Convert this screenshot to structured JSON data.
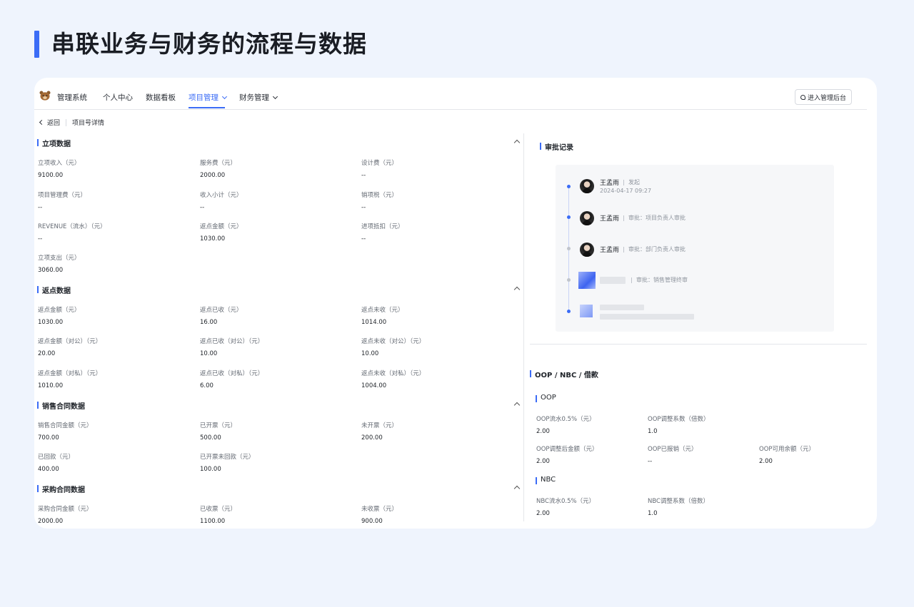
{
  "hero": {
    "title": "串联业务与财务的流程与数据"
  },
  "nav": {
    "brand": "管理系统",
    "items": [
      "个人中心",
      "数据看板",
      "项目管理",
      "财务管理"
    ],
    "admin_button": "进入管理后台"
  },
  "breadcrumb": {
    "back": "返回",
    "current": "项目号详情"
  },
  "sections": {
    "project": {
      "title": "立项数据",
      "fields": [
        {
          "label": "立项收入（元）",
          "value": "9100.00"
        },
        {
          "label": "服务费（元）",
          "value": "2000.00"
        },
        {
          "label": "设计费（元）",
          "value": "--"
        },
        {
          "label": "项目管理费（元）",
          "value": "--"
        },
        {
          "label": "收入小计（元）",
          "value": "--"
        },
        {
          "label": "销项税（元）",
          "value": "--"
        },
        {
          "label": "REVENUE（流水）（元）",
          "value": "--"
        },
        {
          "label": "返点金额（元）",
          "value": "1030.00"
        },
        {
          "label": "进项抵扣（元）",
          "value": "--"
        },
        {
          "label": "立项支出（元）",
          "value": "3060.00"
        }
      ]
    },
    "rebate": {
      "title": "返点数据",
      "fields": [
        {
          "label": "返点金额（元）",
          "value": "1030.00"
        },
        {
          "label": "返点已收（元）",
          "value": "16.00"
        },
        {
          "label": "返点未收（元）",
          "value": "1014.00"
        },
        {
          "label": "返点金额（对公）（元）",
          "value": "20.00"
        },
        {
          "label": "返点已收（对公）（元）",
          "value": "10.00"
        },
        {
          "label": "返点未收（对公）（元）",
          "value": "10.00"
        },
        {
          "label": "返点金额（对私）（元）",
          "value": "1010.00"
        },
        {
          "label": "返点已收（对私）（元）",
          "value": "6.00"
        },
        {
          "label": "返点未收（对私）（元）",
          "value": "1004.00"
        }
      ]
    },
    "sales": {
      "title": "销售合同数据",
      "fields": [
        {
          "label": "销售合同金额（元）",
          "value": "700.00"
        },
        {
          "label": "已开票（元）",
          "value": "500.00"
        },
        {
          "label": "未开票（元）",
          "value": "200.00"
        },
        {
          "label": "已回款（元）",
          "value": "400.00"
        },
        {
          "label": "已开票未回款（元）",
          "value": "100.00"
        }
      ]
    },
    "purchase": {
      "title": "采购合同数据",
      "fields": [
        {
          "label": "采购合同金额（元）",
          "value": "2000.00"
        },
        {
          "label": "已收票（元）",
          "value": "1100.00"
        },
        {
          "label": "未收票（元）",
          "value": "900.00"
        }
      ]
    }
  },
  "approval": {
    "title": "审批记录",
    "records": [
      {
        "name": "王孟雨",
        "action": "发起",
        "time": "2024-04-17 09:27"
      },
      {
        "name": "王孟雨",
        "action": "审批：项目负责人审批"
      },
      {
        "name": "王孟雨",
        "action": "审批：部门负责人审批"
      },
      {
        "name": "",
        "action": "审批：销售管理终审"
      }
    ]
  },
  "oop": {
    "title": "OOP / NBC / 借款",
    "oop_title": "OOP",
    "oop_fields": [
      {
        "label": "OOP流水0.5%（元）",
        "value": "2.00"
      },
      {
        "label": "OOP调整系数（倍数）",
        "value": "1.0"
      },
      {
        "label": "OOP调整后金额（元）",
        "value": "2.00"
      },
      {
        "label": "OOP已报销（元）",
        "value": "--"
      },
      {
        "label": "OOP可用余额（元）",
        "value": "2.00"
      }
    ],
    "nbc_title": "NBC",
    "nbc_fields": [
      {
        "label": "NBC流水0.5%（元）",
        "value": "2.00"
      },
      {
        "label": "NBC调整系数（倍数）",
        "value": "1.0"
      }
    ]
  }
}
